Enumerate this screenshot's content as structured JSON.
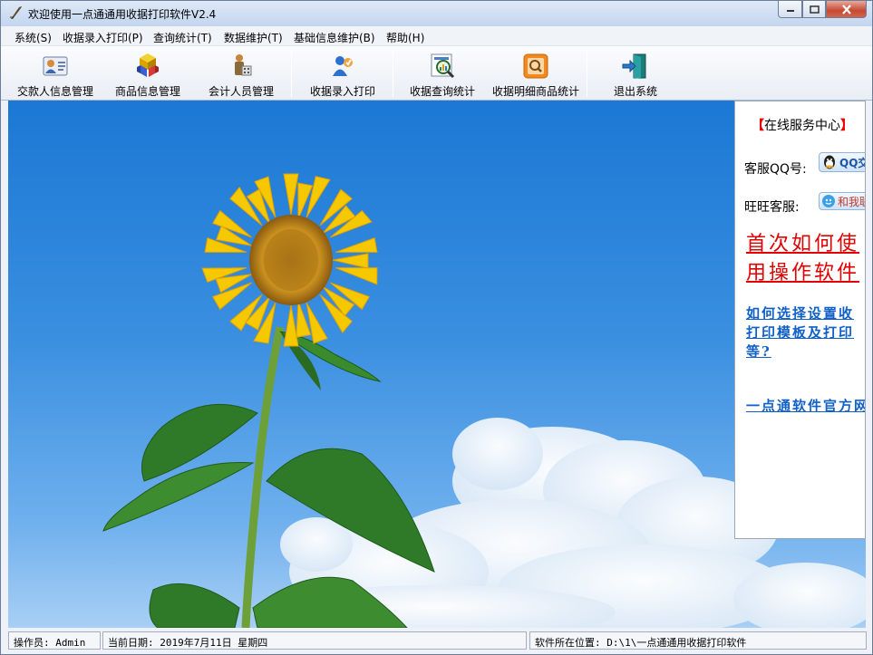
{
  "window": {
    "title": "欢迎使用一点通通用收据打印软件V2.4"
  },
  "menu": [
    {
      "label": "系统(S)"
    },
    {
      "label": "收据录入打印(P)"
    },
    {
      "label": "查询统计(T)"
    },
    {
      "label": "数据维护(T)"
    },
    {
      "label": "基础信息维护(B)"
    },
    {
      "label": "帮助(H)"
    }
  ],
  "toolbar": [
    {
      "label": "交款人信息管理",
      "icon": "person-card-icon"
    },
    {
      "label": "商品信息管理",
      "icon": "cubes-icon"
    },
    {
      "label": "会计人员管理",
      "icon": "accountant-icon"
    },
    {
      "label": "收据录入打印",
      "icon": "user-print-icon"
    },
    {
      "label": "收据查询统计",
      "icon": "magnifier-chart-icon"
    },
    {
      "label": "收据明细商品统计",
      "icon": "orange-search-icon"
    },
    {
      "label": "退出系统",
      "icon": "exit-door-icon"
    }
  ],
  "service_panel": {
    "title_open": "【",
    "title_text": "在线服务中心",
    "title_close": "】",
    "qq_label": "客服QQ号:",
    "qq_button": "QQ交",
    "wangwang_label": "旺旺客服:",
    "wangwang_button": "和我联",
    "link1_line1": "首次如何使",
    "link1_line2": "用操作软件",
    "link2_line1": "如何选择设置收",
    "link2_line2": "打印模板及打印",
    "link2_line3": "等?",
    "link3": "一点通软件官方网"
  },
  "status": {
    "operator": "操作员: Admin",
    "date": "当前日期: 2019年7月11日 星期四",
    "location": "软件所在位置: D:\\1\\一点通通用收据打印软件"
  },
  "colors": {
    "sky": "#2a84dc",
    "red_link": "#e00000",
    "blue_link": "#1060c8"
  }
}
